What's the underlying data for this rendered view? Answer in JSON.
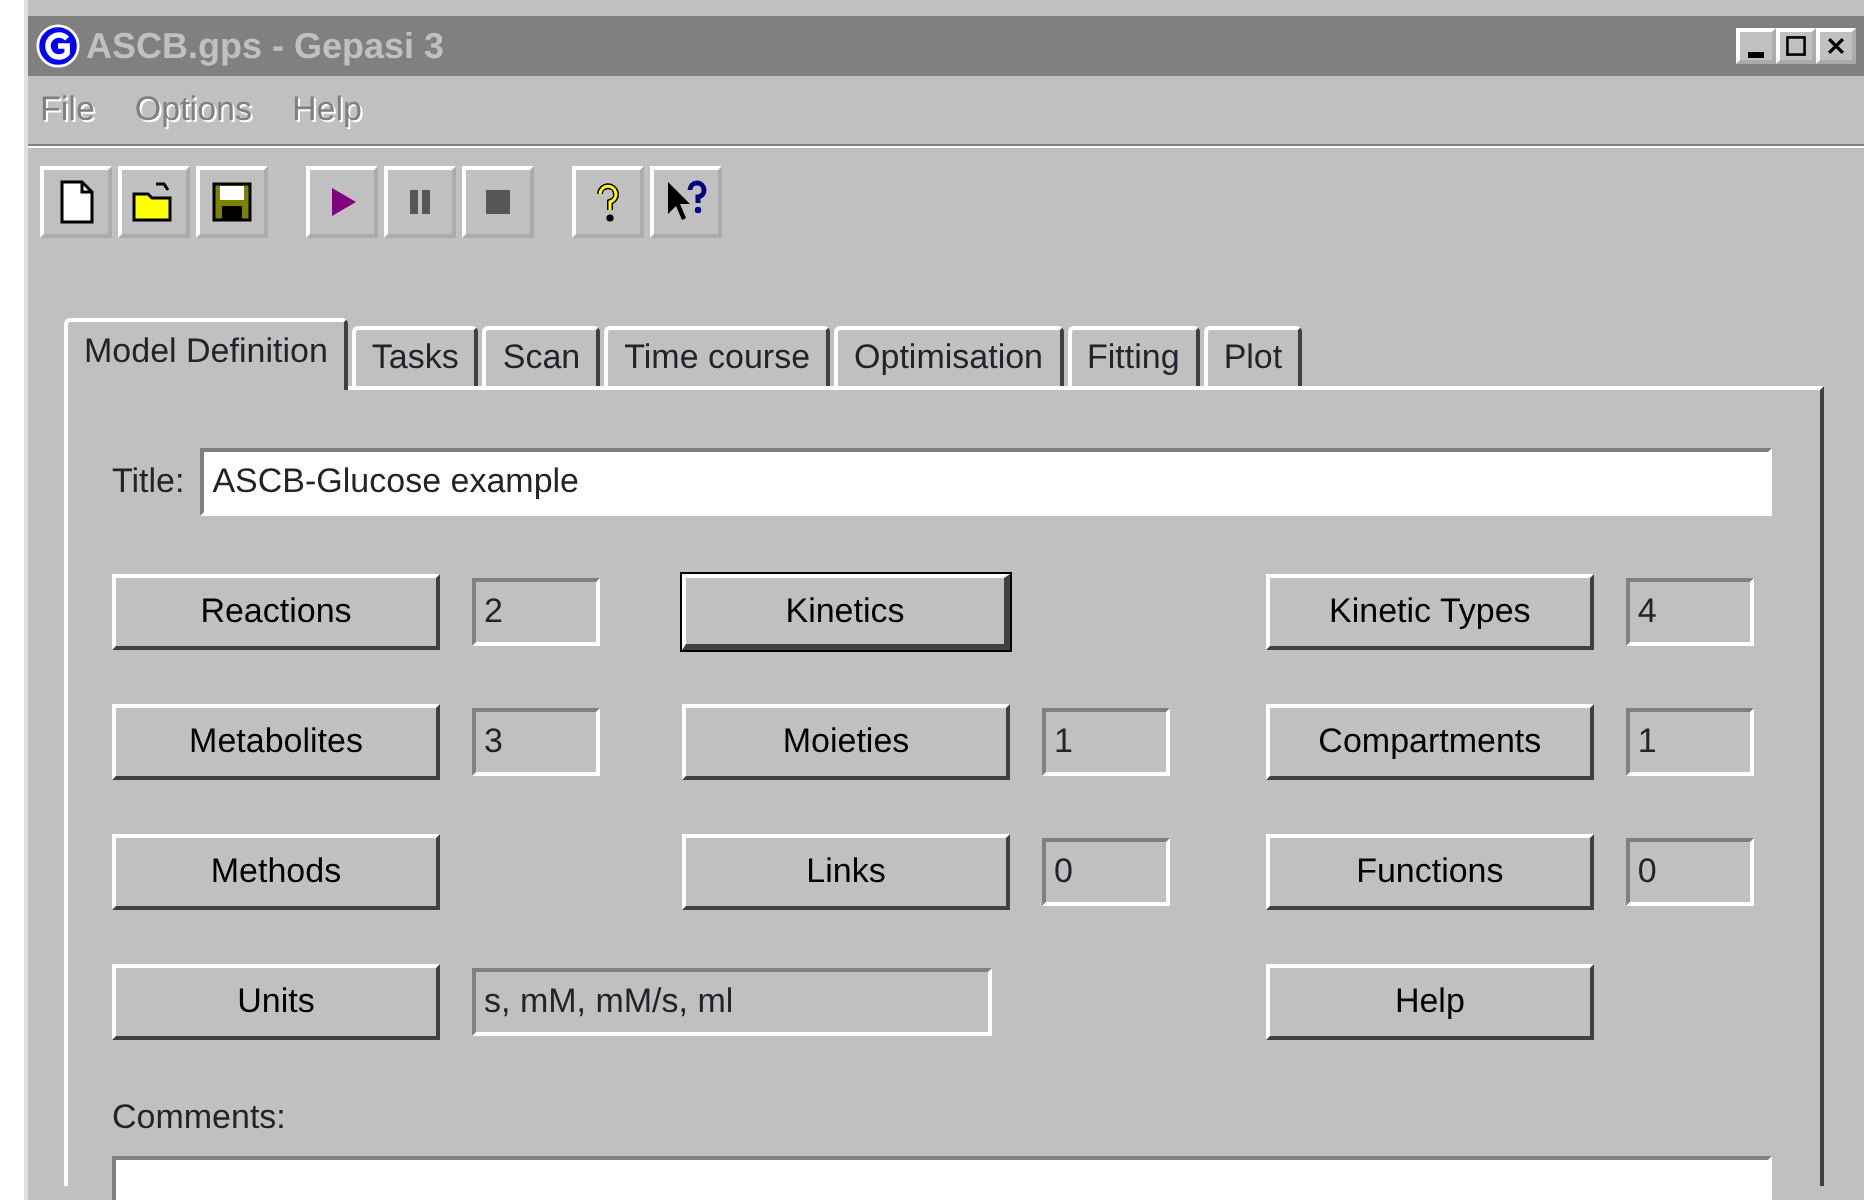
{
  "window": {
    "title": "ASCB.gps - Gepasi 3"
  },
  "menu": [
    {
      "label": "File"
    },
    {
      "label": "Options"
    },
    {
      "label": "Help"
    }
  ],
  "toolbar": [
    [
      {
        "kind": "new",
        "disabled": false
      },
      {
        "kind": "open",
        "disabled": false
      },
      {
        "kind": "save",
        "disabled": false
      }
    ],
    [
      {
        "kind": "run",
        "disabled": false
      },
      {
        "kind": "pause",
        "disabled": true
      },
      {
        "kind": "stop",
        "disabled": true
      }
    ],
    [
      {
        "kind": "help",
        "disabled": false
      },
      {
        "kind": "context-help",
        "disabled": false
      }
    ]
  ],
  "tabs": [
    {
      "label": "Model Definition",
      "selected": true
    },
    {
      "label": "Tasks",
      "selected": false
    },
    {
      "label": "Scan",
      "selected": false
    },
    {
      "label": "Time course",
      "selected": false
    },
    {
      "label": "Optimisation",
      "selected": false
    },
    {
      "label": "Fitting",
      "selected": false
    },
    {
      "label": "Plot",
      "selected": false
    }
  ],
  "title_field": {
    "label": "Title:",
    "value": "ASCB-Glucose example"
  },
  "rows": [
    [
      {
        "button": "Reactions",
        "value": "2",
        "default": false
      },
      {
        "button": "Kinetics",
        "default": true
      },
      {
        "button": "Kinetic Types",
        "value": "4",
        "default": false
      }
    ],
    [
      {
        "button": "Metabolites",
        "value": "3",
        "default": false
      },
      {
        "button": "Moieties",
        "value": "1",
        "default": false
      },
      {
        "button": "Compartments",
        "value": "1",
        "default": false
      }
    ],
    [
      {
        "button": "Methods",
        "default": false
      },
      {
        "button": "Links",
        "value": "0",
        "default": false
      },
      {
        "button": "Functions",
        "value": "0",
        "default": false
      }
    ],
    [
      {
        "button": "Units",
        "value": "s, mM, mM/s, ml",
        "wide": true,
        "default": false
      },
      null,
      {
        "button": "Help",
        "default": false
      }
    ]
  ],
  "comments": {
    "label": "Comments:"
  }
}
